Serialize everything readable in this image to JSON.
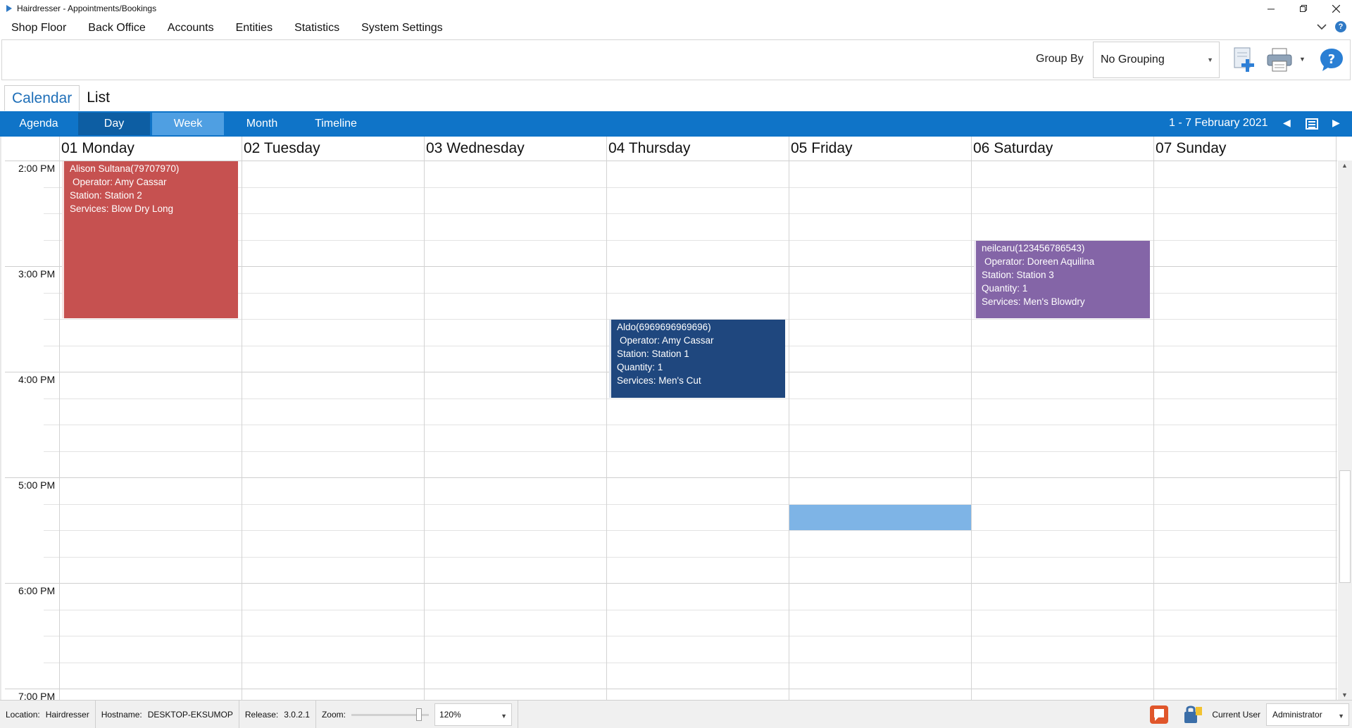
{
  "window": {
    "title": "Hairdresser - Appointments/Bookings",
    "controls": [
      "minimize-icon",
      "restore-icon",
      "close-icon"
    ]
  },
  "menu": {
    "items": [
      "Shop Floor",
      "Back Office",
      "Accounts",
      "Entities",
      "Statistics",
      "System Settings"
    ]
  },
  "toolbar": {
    "group_by_label": "Group By",
    "group_by_value": "No Grouping",
    "icons": [
      "new-appointment-icon",
      "print-icon",
      "help-icon"
    ]
  },
  "view_tabs": {
    "calendar": "Calendar",
    "list": "List",
    "active": "Calendar"
  },
  "nav": {
    "views": [
      "Agenda",
      "Day",
      "Week",
      "Month",
      "Timeline"
    ],
    "selected_view": "Week",
    "date_range": "1 - 7 February 2021"
  },
  "calendar": {
    "days": [
      "01 Monday",
      "02 Tuesday",
      "03 Wednesday",
      "04 Thursday",
      "05 Friday",
      "06 Saturday",
      "07 Sunday"
    ],
    "time_labels": [
      "2:00 PM",
      "3:00 PM",
      "4:00 PM",
      "5:00 PM",
      "6:00 PM",
      "7:00 PM"
    ],
    "appointments": [
      {
        "day": "01 Monday",
        "start": "2:00 PM",
        "end": "3:30 PM",
        "color": "#c65150",
        "client": "Alison Sultana(79707970)",
        "operator": "Operator: Amy Cassar",
        "station": "Station: Station 2",
        "services": "Services: Blow Dry Long"
      },
      {
        "day": "04 Thursday",
        "start": "3:30 PM",
        "end": "4:15 PM",
        "color": "#1f477e",
        "client": "Aldo(6969696969696)",
        "operator": "Operator: Amy Cassar",
        "station": "Station: Station 1",
        "quantity": "Quantity: 1",
        "services": "Services: Men's Cut"
      },
      {
        "day": "06 Saturday",
        "start": "2:45 PM",
        "end": "3:30 PM",
        "color": "#8465a7",
        "client": "neilcaru(123456786543)",
        "operator": "Operator: Doreen Aquilina",
        "station": "Station: Station 3",
        "quantity": "Quantity: 1",
        "services": "Services: Men's Blowdry"
      }
    ],
    "selected_slot": {
      "day": "05 Friday",
      "start": "5:15 PM",
      "end": "5:30 PM",
      "color": "#7eb4e6"
    }
  },
  "status": {
    "location_label": "Location:",
    "location_value": "Hairdresser",
    "hostname_label": "Hostname:",
    "hostname_value": "DESKTOP-EKSUMOP",
    "release_label": "Release:",
    "release_value": "3.0.2.1",
    "zoom_label": "Zoom:",
    "zoom_value": "120%",
    "zoom_level": 0.9,
    "current_user_label": "Current User",
    "current_user_value": "Administrator"
  },
  "colors": {
    "accent": "#0f74c8",
    "day_button": "#0d5ea3",
    "week_button": "#4f9fe2"
  }
}
